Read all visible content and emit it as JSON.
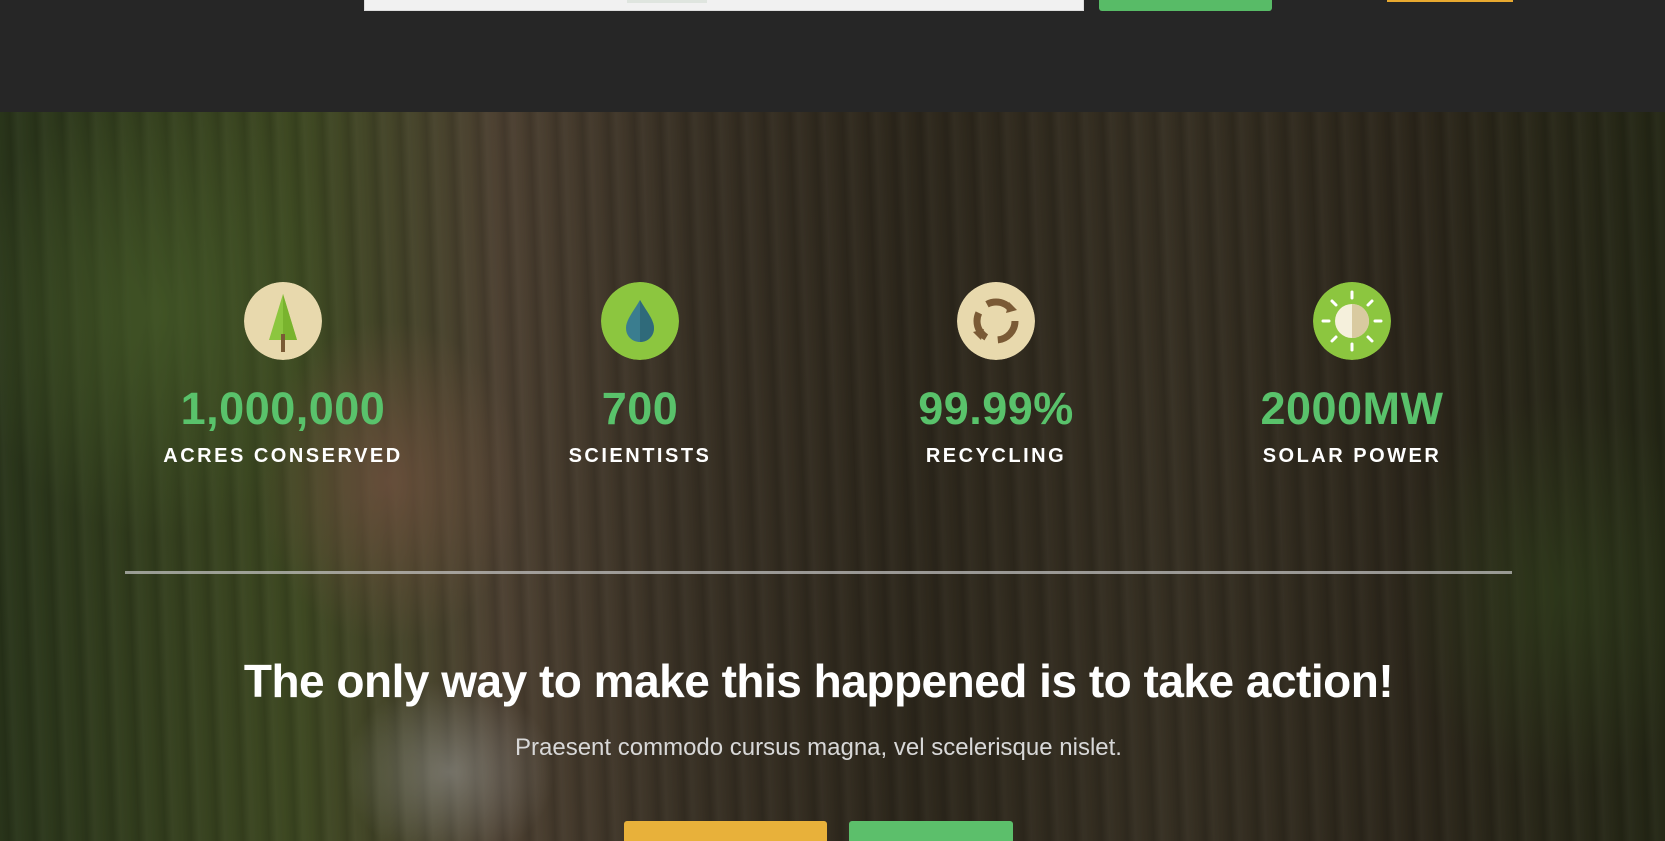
{
  "colors": {
    "accent_green": "#59c26b",
    "accent_orange": "#e8b13a",
    "topbar_bg": "#262626"
  },
  "stats": [
    {
      "icon": "tree-icon",
      "value": "1,000,000",
      "label": "ACRES CONSERVED"
    },
    {
      "icon": "water-drop-icon",
      "value": "700",
      "label": "SCIENTISTS"
    },
    {
      "icon": "recycle-icon",
      "value": "99.99%",
      "label": "RECYCLING"
    },
    {
      "icon": "sun-icon",
      "value": "2000MW",
      "label": "SOLAR POWER"
    }
  ],
  "cta": {
    "headline": "The only way to make this happened is to take action!",
    "subline": "Praesent commodo cursus magna, vel scelerisque nislet."
  }
}
